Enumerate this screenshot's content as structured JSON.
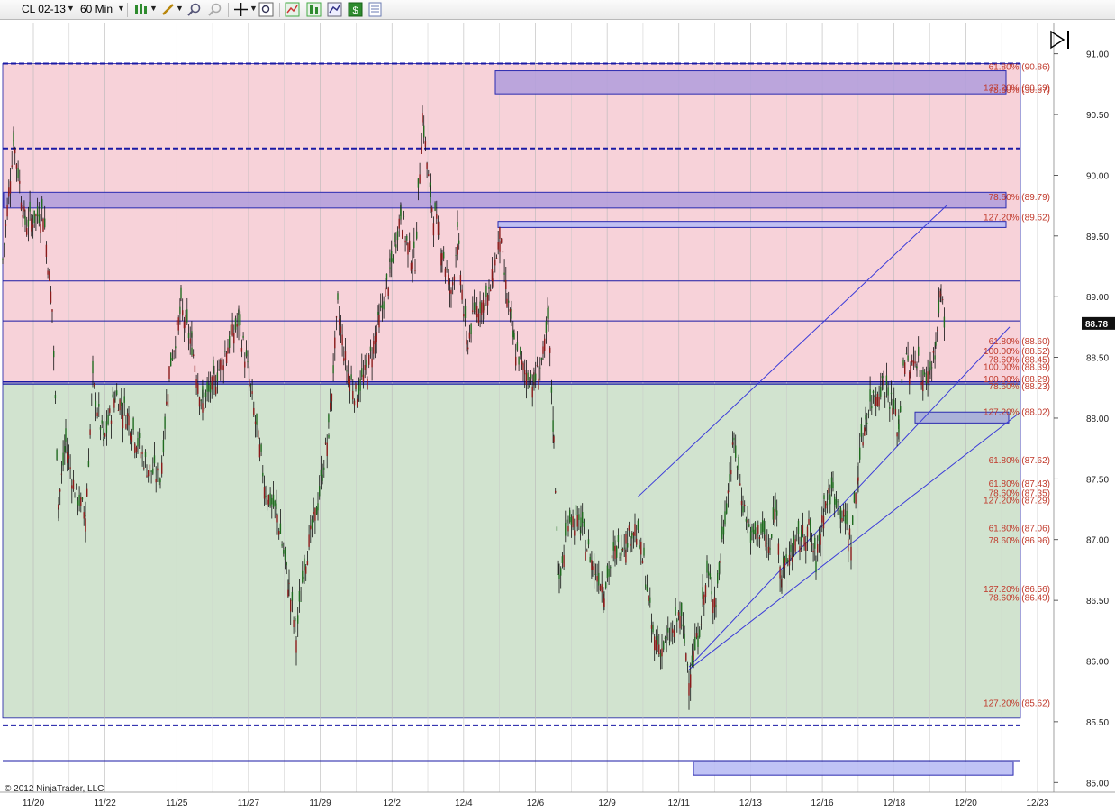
{
  "toolbar": {
    "instrument": "CL 02-13",
    "interval": "60 Min",
    "icons": [
      "candlestick-style-icon",
      "draw-line-icon",
      "zoom-in-icon",
      "zoom-out-icon",
      "crosshair-icon",
      "data-box-icon",
      "strategies-icon",
      "indicators-icon",
      "chart-trader-icon",
      "properties-icon"
    ]
  },
  "copyright": "© 2012 NinjaTrader, LLC",
  "last_price_label": "88.78",
  "colors": {
    "resistance_zone": "#f7d2d9",
    "support_zone": "#d1e3cf",
    "price_line": "#1a1aa5",
    "fib_text": "#c0392b",
    "supply_box": "#b4a0dc",
    "demand_box": "#b9bdf4",
    "bull_candle": "#1f6b1f",
    "bear_candle": "#8b1a1a"
  },
  "chart_data": {
    "type": "candlestick",
    "instrument": "CL 02-13",
    "interval": "60 Min",
    "ylim": [
      84.95,
      91.25
    ],
    "y_ticks": [
      "91.00",
      "90.50",
      "90.00",
      "89.50",
      "89.00",
      "88.50",
      "88.00",
      "87.50",
      "87.00",
      "86.50",
      "86.00",
      "85.50",
      "85.00"
    ],
    "x_ticks": [
      "11/20",
      "11/22",
      "11/25",
      "11/27",
      "11/29",
      "12/2",
      "12/4",
      "12/6",
      "12/9",
      "12/11",
      "12/13",
      "12/16",
      "12/18",
      "12/20",
      "12/23"
    ],
    "last_price": 88.78,
    "price_path": [
      [
        0,
        89.3
      ],
      [
        12,
        90.3
      ],
      [
        25,
        89.6
      ],
      [
        45,
        89.7
      ],
      [
        55,
        88.9
      ],
      [
        62,
        87.3
      ],
      [
        70,
        87.8
      ],
      [
        80,
        87.4
      ],
      [
        92,
        87.2
      ],
      [
        100,
        88.3
      ],
      [
        112,
        87.8
      ],
      [
        125,
        88.2
      ],
      [
        140,
        88.0
      ],
      [
        150,
        87.8
      ],
      [
        160,
        87.6
      ],
      [
        175,
        87.5
      ],
      [
        185,
        88.4
      ],
      [
        198,
        88.9
      ],
      [
        210,
        88.6
      ],
      [
        222,
        88.1
      ],
      [
        235,
        88.3
      ],
      [
        250,
        88.6
      ],
      [
        262,
        88.8
      ],
      [
        272,
        88.4
      ],
      [
        282,
        87.9
      ],
      [
        292,
        87.4
      ],
      [
        305,
        87.2
      ],
      [
        318,
        86.6
      ],
      [
        326,
        86.2
      ],
      [
        335,
        86.8
      ],
      [
        350,
        87.3
      ],
      [
        362,
        87.9
      ],
      [
        372,
        88.9
      ],
      [
        382,
        88.4
      ],
      [
        392,
        88.2
      ],
      [
        405,
        88.4
      ],
      [
        418,
        88.8
      ],
      [
        430,
        89.2
      ],
      [
        442,
        89.7
      ],
      [
        450,
        89.4
      ],
      [
        458,
        89.3
      ],
      [
        466,
        90.5
      ],
      [
        475,
        89.8
      ],
      [
        488,
        89.4
      ],
      [
        498,
        89.0
      ],
      [
        505,
        89.5
      ],
      [
        515,
        88.6
      ],
      [
        525,
        88.9
      ],
      [
        540,
        89.0
      ],
      [
        552,
        89.5
      ],
      [
        560,
        89.0
      ],
      [
        568,
        88.6
      ],
      [
        578,
        88.4
      ],
      [
        590,
        88.3
      ],
      [
        600,
        88.5
      ],
      [
        606,
        88.8
      ],
      [
        612,
        87.8
      ],
      [
        618,
        86.6
      ],
      [
        628,
        87.2
      ],
      [
        642,
        87.1
      ],
      [
        655,
        86.8
      ],
      [
        668,
        86.6
      ],
      [
        680,
        86.9
      ],
      [
        692,
        87.0
      ],
      [
        702,
        87.1
      ],
      [
        712,
        86.8
      ],
      [
        722,
        86.2
      ],
      [
        732,
        86.1
      ],
      [
        742,
        86.2
      ],
      [
        752,
        86.4
      ],
      [
        762,
        85.9
      ],
      [
        772,
        86.2
      ],
      [
        782,
        86.7
      ],
      [
        792,
        86.5
      ],
      [
        802,
        87.2
      ],
      [
        812,
        87.8
      ],
      [
        822,
        87.3
      ],
      [
        832,
        87.0
      ],
      [
        842,
        87.1
      ],
      [
        852,
        86.9
      ],
      [
        858,
        87.3
      ],
      [
        865,
        86.7
      ],
      [
        875,
        86.9
      ],
      [
        885,
        87.0
      ],
      [
        895,
        87.1
      ],
      [
        903,
        86.8
      ],
      [
        912,
        87.3
      ],
      [
        922,
        87.4
      ],
      [
        932,
        87.2
      ],
      [
        942,
        87.0
      ],
      [
        950,
        87.6
      ],
      [
        958,
        88.0
      ],
      [
        968,
        88.2
      ],
      [
        978,
        88.3
      ],
      [
        988,
        88.1
      ],
      [
        995,
        87.9
      ],
      [
        1000,
        88.5
      ],
      [
        1008,
        88.4
      ],
      [
        1015,
        88.5
      ],
      [
        1022,
        88.3
      ],
      [
        1030,
        88.4
      ],
      [
        1036,
        88.6
      ],
      [
        1042,
        89.05
      ],
      [
        1046,
        88.78
      ]
    ],
    "horizontal_levels": [
      {
        "price": 90.92,
        "style": "dashed"
      },
      {
        "price": 90.22,
        "style": "dashed"
      },
      {
        "price": 89.13,
        "style": "solid"
      },
      {
        "price": 88.8,
        "style": "solid"
      },
      {
        "price": 88.3,
        "style": "solid"
      },
      {
        "price": 88.28,
        "style": "solid"
      },
      {
        "price": 85.47,
        "style": "dashed"
      },
      {
        "price": 85.18,
        "style": "solid"
      }
    ],
    "zones": [
      {
        "name": "resistance",
        "from": 88.29,
        "to": 90.92
      },
      {
        "name": "support",
        "from": 85.53,
        "to": 88.29
      }
    ],
    "boxes": [
      {
        "kind": "supply",
        "x0": 550,
        "x1": 1117,
        "top": 90.86,
        "bottom": 90.67
      },
      {
        "kind": "supply",
        "x0": 4,
        "x1": 1117,
        "top": 89.86,
        "bottom": 89.73
      },
      {
        "kind": "demand",
        "x0": 553,
        "x1": 1117,
        "top": 89.62,
        "bottom": 89.57
      },
      {
        "kind": "demand",
        "x0": 770,
        "x1": 1125,
        "top": 85.17,
        "bottom": 85.06
      },
      {
        "kind": "neutral",
        "x0": 1016,
        "x1": 1120,
        "top": 88.05,
        "bottom": 87.96
      }
    ],
    "fib_annotations": [
      {
        "label": "61.80% (90.86)",
        "price": 90.86
      },
      {
        "label": "127.20% (90.69)",
        "price": 90.69
      },
      {
        "label": "78.60% (90.67)",
        "price": 90.67
      },
      {
        "label": "78.60% (89.79)",
        "price": 89.79
      },
      {
        "label": "127.20% (89.62)",
        "price": 89.62
      },
      {
        "label": "61.80% (88.60)",
        "price": 88.6
      },
      {
        "label": "100.00% (88.52)",
        "price": 88.52
      },
      {
        "label": "78.60% (88.45)",
        "price": 88.45
      },
      {
        "label": "100.00% (88.39)",
        "price": 88.39
      },
      {
        "label": "100.00% (88.29)",
        "price": 88.29
      },
      {
        "label": "78.60% (88.23)",
        "price": 88.23
      },
      {
        "label": "127.20% (88.02)",
        "price": 88.02
      },
      {
        "label": "61.80% (87.62)",
        "price": 87.62
      },
      {
        "label": "61.80% (87.43)",
        "price": 87.43
      },
      {
        "label": "78.60% (87.35)",
        "price": 87.35
      },
      {
        "label": "127.20% (87.29)",
        "price": 87.29
      },
      {
        "label": "61.80% (87.06)",
        "price": 87.06
      },
      {
        "label": "78.60% (86.96)",
        "price": 86.96
      },
      {
        "label": "127.20% (86.56)",
        "price": 86.56
      },
      {
        "label": "78.60% (86.49)",
        "price": 86.49
      },
      {
        "label": "127.20% (85.62)",
        "price": 85.62
      }
    ],
    "trend_channels": [
      {
        "from": [
          762,
          85.95
        ],
        "to": [
          1118,
          88.75
        ]
      },
      {
        "from": [
          705,
          87.35
        ],
        "to": [
          1048,
          89.75
        ]
      },
      {
        "from": [
          762,
          85.93
        ],
        "to": [
          1130,
          88.05
        ]
      }
    ]
  }
}
